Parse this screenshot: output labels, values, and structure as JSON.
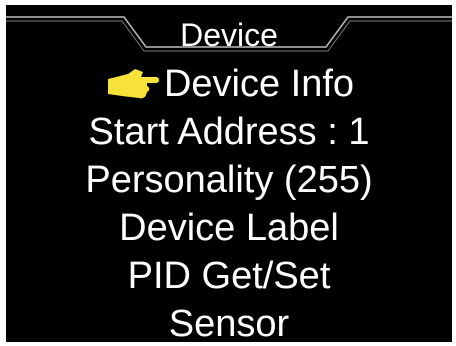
{
  "header": {
    "title": "Device"
  },
  "menu": {
    "items": [
      {
        "label": "Device Info",
        "selected": true
      },
      {
        "label": "Start Address : 1",
        "selected": false
      },
      {
        "label": "Personality (255)",
        "selected": false
      },
      {
        "label": "Device Label",
        "selected": false
      },
      {
        "label": "PID Get/Set",
        "selected": false
      },
      {
        "label": "Sensor",
        "selected": false
      }
    ]
  },
  "icons": {
    "selection_pointer": "pointing-hand-icon"
  },
  "colors": {
    "background": "#000000",
    "text": "#ffffff",
    "pointer": "#f7e23a"
  }
}
